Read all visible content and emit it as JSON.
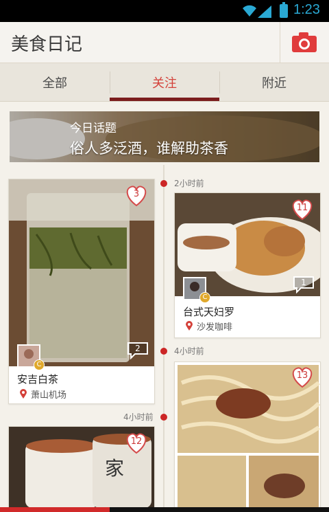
{
  "status_bar": {
    "time": "1:23"
  },
  "app_bar": {
    "title": "美食日记"
  },
  "tabs": [
    {
      "label": "全部",
      "active": false
    },
    {
      "label": "关注",
      "active": true
    },
    {
      "label": "附近",
      "active": false
    }
  ],
  "topic": {
    "label": "今日话题",
    "text": "俗人多泛酒，谁解助茶香"
  },
  "timeline": [
    {
      "time": "2小时前"
    },
    {
      "time": "4小时前"
    },
    {
      "time": "4小时前"
    }
  ],
  "posts": [
    {
      "title": "安吉白茶",
      "location": "萧山机场",
      "likes": "3",
      "comments": "2"
    },
    {
      "title": "台式天妇罗",
      "location": "沙发咖啡",
      "likes": "11",
      "comments": "1"
    },
    {
      "title": "",
      "location": "",
      "likes": "13",
      "comments": ""
    },
    {
      "title": "",
      "location": "",
      "likes": "12",
      "comments": ""
    }
  ],
  "badge_letter": "C",
  "colors": {
    "accent": "#d4413a",
    "tab_indicator": "#7b1d1d",
    "status_blue": "#2aa9d4"
  }
}
